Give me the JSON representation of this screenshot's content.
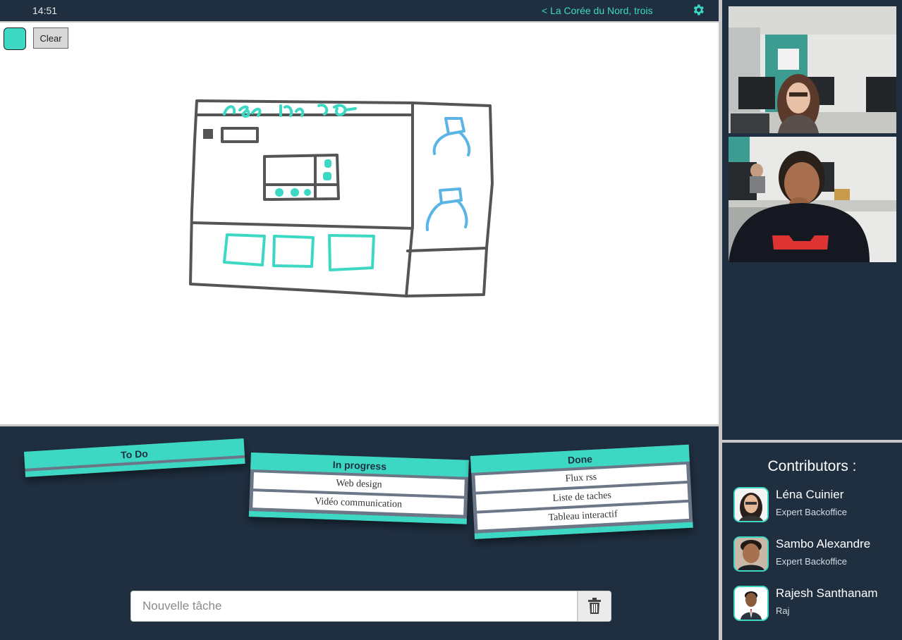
{
  "topbar": {
    "time": "14:51",
    "room_link": "< La Corée du Nord, trois",
    "settings_icon": "gear-icon"
  },
  "canvas": {
    "color": "#3dd8c4",
    "clear_label": "Clear"
  },
  "board": {
    "columns": [
      {
        "title": "To Do",
        "tasks": []
      },
      {
        "title": "In progress",
        "tasks": [
          "Web design",
          "Vidéo communication"
        ]
      },
      {
        "title": "Done",
        "tasks": [
          "Flux rss",
          "Liste de taches",
          "Tableau interactif"
        ]
      }
    ],
    "new_task_placeholder": "Nouvelle tâche",
    "delete_icon": "trash-icon"
  },
  "contributors": {
    "title": "Contributors :",
    "people": [
      {
        "name": "Léna Cuinier",
        "role": "Expert Backoffice"
      },
      {
        "name": "Sambo Alexandre",
        "role": "Expert Backoffice"
      },
      {
        "name": "Rajesh Santhanam",
        "role": "Raj"
      }
    ]
  },
  "colors": {
    "accent": "#3dd8c4",
    "background": "#1f2f40",
    "sketch_gray": "#555555",
    "sketch_blue": "#5ab4e6"
  }
}
